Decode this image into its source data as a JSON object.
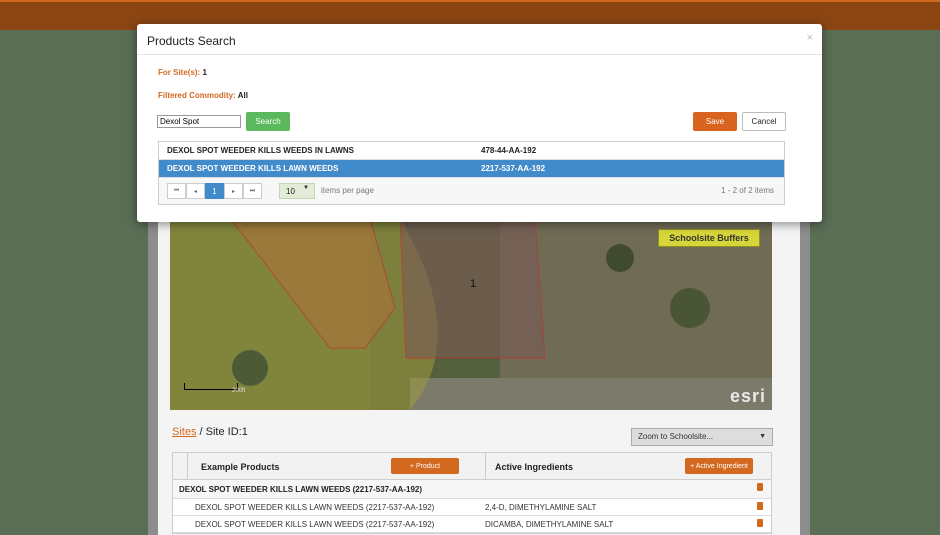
{
  "modal": {
    "title": "Products Search",
    "close": "×",
    "site_label": "For Site(s):",
    "site_value": "1",
    "commodity_label": "Filtered Commodity:",
    "commodity_value": "All",
    "search_value": "Dexol Spot",
    "search_button": "Search",
    "save_button": "Save",
    "cancel_button": "Cancel",
    "results": [
      {
        "name": "DEXOL SPOT WEEDER KILLS WEEDS IN LAWNS",
        "reg": "478-44-AA-192",
        "selected": false
      },
      {
        "name": "DEXOL SPOT WEEDER KILLS LAWN WEEDS",
        "reg": "2217-537-AA-192",
        "selected": true
      }
    ],
    "pager": {
      "first": "⏮",
      "prev": "◂",
      "current_page": "1",
      "next": "▸",
      "last": "⏭",
      "page_size": "10",
      "items_per_page_label": "items per page",
      "info": "1 - 2 of 2 items"
    }
  },
  "map": {
    "legend_chip": "Schoolsite Buffers",
    "site_label": "1",
    "scale_text": "200ft",
    "logo": "esri"
  },
  "page": {
    "breadcrumb_link": "Sites",
    "breadcrumb_rest": " / Site ID:1",
    "zoom_select": "Zoom to Schoolsite...",
    "table": {
      "col_products": "Example Products",
      "add_product": "+ Product",
      "col_ingredients": "Active Ingredients",
      "add_ingredient": "+ Active Ingredient",
      "group_row": "DEXOL SPOT WEEDER KILLS LAWN WEEDS (2217-537-AA-192)",
      "rows": [
        {
          "product": "DEXOL SPOT WEEDER KILLS LAWN WEEDS (2217-537-AA-192)",
          "ingredient": "2,4-D, DIMETHYLAMINE SALT"
        },
        {
          "product": "DEXOL SPOT WEEDER KILLS LAWN WEEDS (2217-537-AA-192)",
          "ingredient": "DICAMBA, DIMETHYLAMINE SALT"
        }
      ]
    }
  },
  "colors": {
    "accent_orange": "#d2691e",
    "selected_blue": "#428bca",
    "search_green": "#5cb85c"
  }
}
